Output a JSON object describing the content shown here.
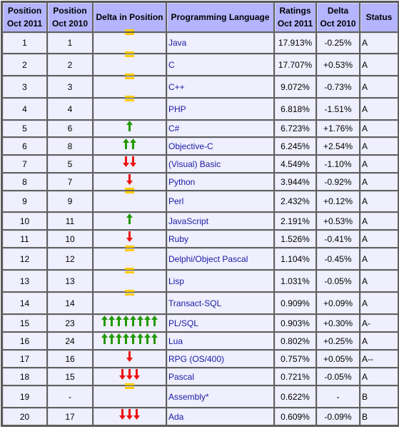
{
  "headers": {
    "pos2011": [
      "Position",
      "Oct 2011"
    ],
    "pos2010": [
      "Position",
      "Oct 2010"
    ],
    "delta_pos": "Delta in Position",
    "language": "Programming Language",
    "ratings": [
      "Ratings",
      "Oct 2011"
    ],
    "delta": [
      "Delta",
      "Oct 2010"
    ],
    "status": "Status"
  },
  "colors": {
    "header_bg": "#b4b4ff",
    "cell_bg": "#efeffd",
    "link": "#1a1aa6",
    "up_arrow": "#229900",
    "down_arrow": "#ee1111",
    "equal": "#ffcc00"
  },
  "rows": [
    {
      "pos2011": "1",
      "pos2010": "1",
      "trend": "equal",
      "arrows": 1,
      "language": "Java",
      "rating": "17.913%",
      "delta": "-0.25%",
      "status": "A"
    },
    {
      "pos2011": "2",
      "pos2010": "2",
      "trend": "equal",
      "arrows": 1,
      "language": "C",
      "rating": "17.707%",
      "delta": "+0.53%",
      "status": "A"
    },
    {
      "pos2011": "3",
      "pos2010": "3",
      "trend": "equal",
      "arrows": 1,
      "language": "C++",
      "rating": "9.072%",
      "delta": "-0.73%",
      "status": "A"
    },
    {
      "pos2011": "4",
      "pos2010": "4",
      "trend": "equal",
      "arrows": 1,
      "language": "PHP",
      "rating": "6.818%",
      "delta": "-1.51%",
      "status": "A"
    },
    {
      "pos2011": "5",
      "pos2010": "6",
      "trend": "up",
      "arrows": 1,
      "language": "C#",
      "rating": "6.723%",
      "delta": "+1.76%",
      "status": "A"
    },
    {
      "pos2011": "6",
      "pos2010": "8",
      "trend": "up",
      "arrows": 2,
      "language": "Objective-C",
      "rating": "6.245%",
      "delta": "+2.54%",
      "status": "A"
    },
    {
      "pos2011": "7",
      "pos2010": "5",
      "trend": "down",
      "arrows": 2,
      "language": "(Visual) Basic",
      "rating": "4.549%",
      "delta": "-1.10%",
      "status": "A"
    },
    {
      "pos2011": "8",
      "pos2010": "7",
      "trend": "down",
      "arrows": 1,
      "language": "Python",
      "rating": "3.944%",
      "delta": "-0.92%",
      "status": "A"
    },
    {
      "pos2011": "9",
      "pos2010": "9",
      "trend": "equal",
      "arrows": 1,
      "language": "Perl",
      "rating": "2.432%",
      "delta": "+0.12%",
      "status": "A"
    },
    {
      "pos2011": "10",
      "pos2010": "11",
      "trend": "up",
      "arrows": 1,
      "language": "JavaScript",
      "rating": "2.191%",
      "delta": "+0.53%",
      "status": "A"
    },
    {
      "pos2011": "11",
      "pos2010": "10",
      "trend": "down",
      "arrows": 1,
      "language": "Ruby",
      "rating": "1.526%",
      "delta": "-0.41%",
      "status": "A"
    },
    {
      "pos2011": "12",
      "pos2010": "12",
      "trend": "equal",
      "arrows": 1,
      "language": "Delphi/Object Pascal",
      "rating": "1.104%",
      "delta": "-0.45%",
      "status": "A"
    },
    {
      "pos2011": "13",
      "pos2010": "13",
      "trend": "equal",
      "arrows": 1,
      "language": "Lisp",
      "rating": "1.031%",
      "delta": "-0.05%",
      "status": "A"
    },
    {
      "pos2011": "14",
      "pos2010": "14",
      "trend": "equal",
      "arrows": 1,
      "language": "Transact-SQL",
      "rating": "0.909%",
      "delta": "+0.09%",
      "status": "A"
    },
    {
      "pos2011": "15",
      "pos2010": "23",
      "trend": "up",
      "arrows": 8,
      "language": "PL/SQL",
      "rating": "0.903%",
      "delta": "+0.30%",
      "status": "A-"
    },
    {
      "pos2011": "16",
      "pos2010": "24",
      "trend": "up",
      "arrows": 8,
      "language": "Lua",
      "rating": "0.802%",
      "delta": "+0.25%",
      "status": "A"
    },
    {
      "pos2011": "17",
      "pos2010": "16",
      "trend": "down",
      "arrows": 1,
      "language": "RPG (OS/400)",
      "rating": "0.757%",
      "delta": "+0.05%",
      "status": "A--"
    },
    {
      "pos2011": "18",
      "pos2010": "15",
      "trend": "down",
      "arrows": 3,
      "language": "Pascal",
      "rating": "0.721%",
      "delta": "-0.05%",
      "status": "A"
    },
    {
      "pos2011": "19",
      "pos2010": "-",
      "trend": "equal",
      "arrows": 1,
      "language": "Assembly*",
      "rating": "0.622%",
      "delta": "-",
      "status": "B"
    },
    {
      "pos2011": "20",
      "pos2010": "17",
      "trend": "down",
      "arrows": 3,
      "language": "Ada",
      "rating": "0.609%",
      "delta": "-0.09%",
      "status": "B"
    }
  ]
}
